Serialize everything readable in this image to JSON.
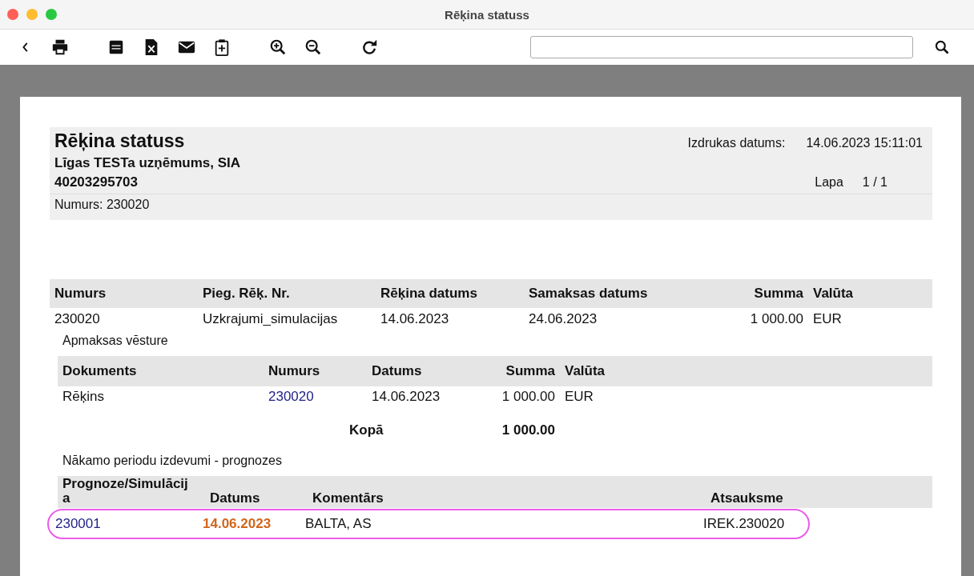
{
  "window": {
    "title": "Rēķina statuss"
  },
  "report": {
    "title": "Rēķina statuss",
    "company": "Līgas TESTa uzņēmums, SIA",
    "reg_no": "40203295703",
    "number_label": "Numurs: 230020",
    "print_date_label": "Izdrukas datums:",
    "print_date": "14.06.2023 15:11:01",
    "page_label": "Lapa",
    "page": "1 / 1"
  },
  "invoice_table": {
    "columns": [
      "Numurs",
      "Pieg. Rēķ. Nr.",
      "Rēķina datums",
      "Samaksas datums",
      "Summa",
      "Valūta"
    ],
    "rows": [
      [
        "230020",
        "Uzkrajumi_simulacijas",
        "14.06.2023",
        "24.06.2023",
        "1 000.00",
        "EUR"
      ]
    ]
  },
  "payment_history": {
    "title": "Apmaksas vēsture",
    "columns": [
      "Dokuments",
      "Numurs",
      "Datums",
      "Summa",
      "Valūta"
    ],
    "rows": [
      [
        "Rēķins",
        "230020",
        "14.06.2023",
        "1 000.00",
        "EUR"
      ]
    ],
    "total_label": "Kopā",
    "total": "1 000.00"
  },
  "forecasts": {
    "title": "Nākamo periodu izdevumi - prognozes",
    "columns": [
      "Prognoze/Simulācija",
      "Datums",
      "Komentārs",
      "Atsauksme"
    ],
    "rows": [
      {
        "cells": [
          "230001",
          "14.06.2023",
          "BALTA, AS",
          "IREK.230020"
        ],
        "highlighted": true
      }
    ]
  }
}
